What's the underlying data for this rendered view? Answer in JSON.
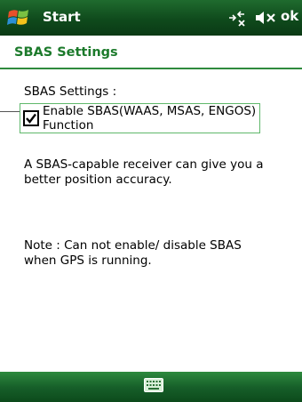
{
  "titlebar": {
    "start_label": "Start",
    "ok_label": "ok",
    "icons": [
      "windows-flag-icon",
      "connectivity-icon",
      "speaker-muted-icon"
    ]
  },
  "header": {
    "title": "SBAS Settings"
  },
  "content": {
    "section_label": "SBAS Settings :",
    "checkbox": {
      "checked": true,
      "label_line1": "Enable SBAS(WAAS, MSAS, ENGOS)",
      "label_line2": "Function"
    },
    "info_line1": "A SBAS-capable receiver can give you a",
    "info_line2": "better position accuracy.",
    "note_line1": "Note : Can not enable/ disable SBAS",
    "note_line2": "when GPS is running."
  },
  "bottombar": {
    "icon": "keyboard-icon"
  },
  "colors": {
    "bar_green": "#0f4a1c",
    "title_green": "#1c7a2b",
    "focus_border": "#5fb86b"
  }
}
